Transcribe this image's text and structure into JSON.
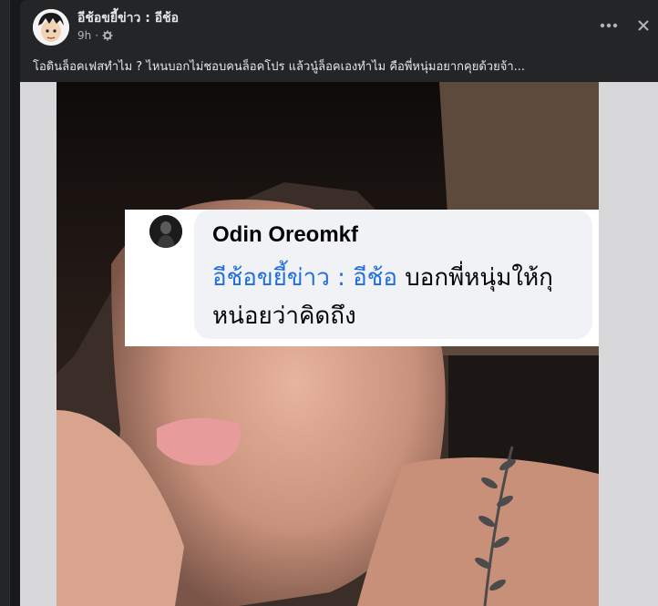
{
  "post": {
    "page_name": "อีช้อขยี้ข่าว : อีช้อ",
    "time": "9h",
    "dot": "·",
    "caption": "โอดินล็อคเฟสทำไม ? ไหนบอกไม่ชอบคนล็อคโปร แล้วนู๋ล็อคเองทำไม คือพี่หนุ่มอยากคุยด้วยจ้า...",
    "privacy_icon": "gear-icon",
    "more_icon": "more-icon",
    "close_icon": "close-icon"
  },
  "comment": {
    "name": "Odin Oreomkf",
    "mention": "อีช้อขยี้ข่าว : อีช้อ",
    "text": " บอกพี่หนุ่มให้กุหน่อยว่าคิดถึง"
  },
  "colors": {
    "background": "#18191a",
    "card": "#242526",
    "text_primary": "#e4e6eb",
    "text_secondary": "#b0b3b8",
    "mention": "#216fdb"
  }
}
